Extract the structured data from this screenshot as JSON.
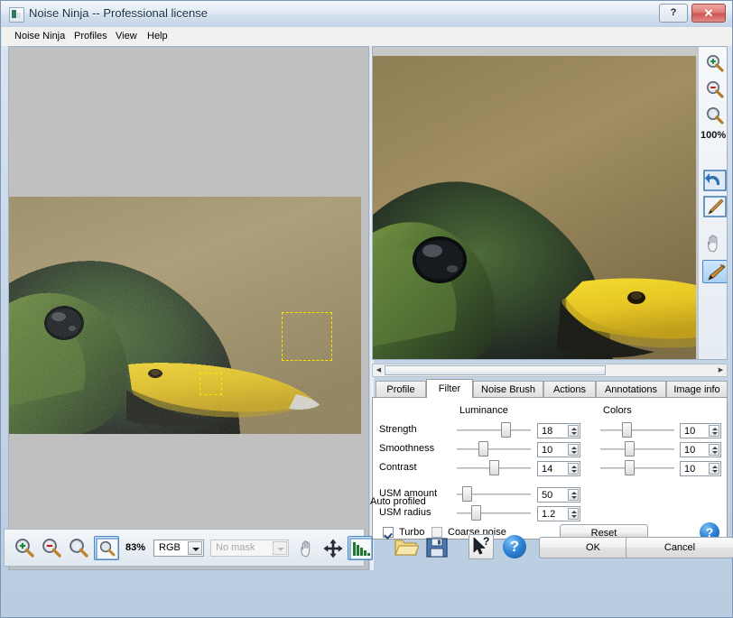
{
  "window": {
    "title": "Noise Ninja -- Professional license",
    "app_icon": "app-icon",
    "help_button": "?",
    "close_button": "✕"
  },
  "menu": {
    "items": [
      {
        "label": "Noise Ninja"
      },
      {
        "label": "Profiles"
      },
      {
        "label": "View"
      },
      {
        "label": "Help"
      }
    ]
  },
  "left_panel": {
    "name": "original-image-canvas",
    "selection_boxes": [
      {
        "name": "noise-sample-box-large"
      },
      {
        "name": "noise-sample-box-small"
      }
    ]
  },
  "preview_panel": {
    "name": "filtered-preview-canvas",
    "zoom_label": "100%",
    "tools": [
      {
        "name": "zoom-in-icon",
        "label": "zoom in"
      },
      {
        "name": "zoom-out-icon",
        "label": "zoom out"
      },
      {
        "name": "zoom-fit-icon",
        "label": "zoom fit"
      },
      {
        "name": "undo-icon",
        "label": "undo"
      },
      {
        "name": "brush-off-icon",
        "label": "brush off"
      },
      {
        "name": "hand-icon",
        "label": "pan"
      },
      {
        "name": "brush-icon",
        "label": "brush"
      }
    ]
  },
  "tabs": [
    {
      "label": "Profile",
      "active": false
    },
    {
      "label": "Filter",
      "active": true
    },
    {
      "label": "Noise Brush",
      "active": false
    },
    {
      "label": "Actions",
      "active": false
    },
    {
      "label": "Annotations",
      "active": false
    },
    {
      "label": "Image info",
      "active": false
    }
  ],
  "filter_panel": {
    "group_luminance": "Luminance",
    "group_colors": "Colors",
    "rows": [
      {
        "label": "Strength",
        "luminance": "18",
        "colors": "10",
        "lum_pct": 60,
        "col_pct": 30
      },
      {
        "label": "Smoothness",
        "luminance": "10",
        "colors": "10",
        "lum_pct": 30,
        "col_pct": 33
      },
      {
        "label": "Contrast",
        "luminance": "14",
        "colors": "10",
        "lum_pct": 44,
        "col_pct": 33
      }
    ],
    "usm_rows": [
      {
        "label": "USM amount",
        "value": "50",
        "pct": 7
      },
      {
        "label": "USM radius",
        "value": "1.2",
        "pct": 18
      }
    ],
    "turbo": {
      "label": "Turbo",
      "checked": true
    },
    "coarse_noise": {
      "label": "Coarse noise",
      "checked": false
    },
    "reset_button": "Reset",
    "help_button": "?"
  },
  "status": {
    "text": "Auto profiled"
  },
  "bottom_bar": {
    "zoom_percent": "83%",
    "channel_select": {
      "value": "RGB"
    },
    "mask_select": {
      "value": "No mask",
      "disabled": true
    },
    "tools": [
      {
        "name": "zoom-in-icon"
      },
      {
        "name": "zoom-out-icon"
      },
      {
        "name": "zoom-fit-icon"
      },
      {
        "name": "zoom-select-icon"
      },
      {
        "name": "hand-icon"
      },
      {
        "name": "move-icon"
      },
      {
        "name": "histogram-icon"
      }
    ],
    "open_icon": "open-folder-icon",
    "save_icon": "save-disk-icon",
    "context_help_icon": "context-help-icon",
    "help_icon": "help-icon",
    "ok_button": "OK",
    "cancel_button": "Cancel"
  },
  "colors": {
    "accent": "#2f86d8",
    "selection": "#ffe400",
    "canvas_bg": "#c0c0c0",
    "title_text": "#1b2f45"
  }
}
